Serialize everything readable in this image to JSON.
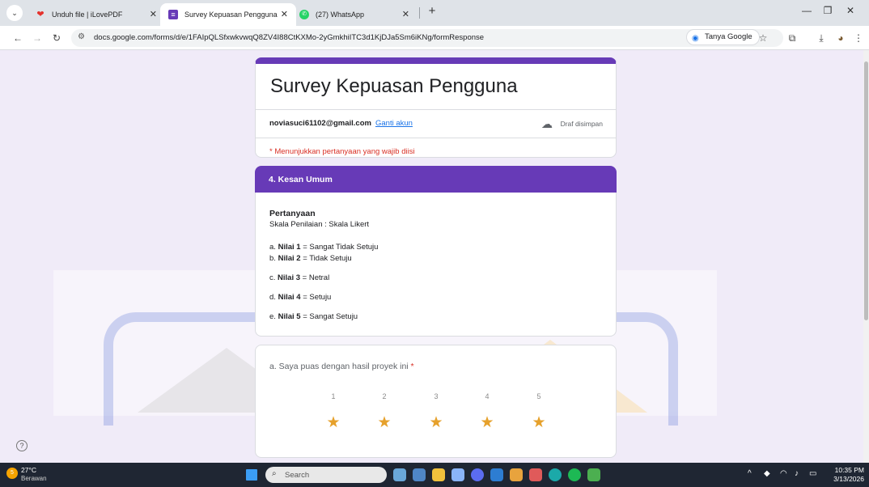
{
  "browser": {
    "tabs": [
      {
        "title": "Unduh file | iLovePDF",
        "icon": "heart-icon",
        "color": "#e5322d"
      },
      {
        "title": "Survey Kepuasan Pengguna",
        "icon": "forms-icon",
        "color": "#673ab7"
      },
      {
        "title": "(27) WhatsApp",
        "icon": "whatsapp-icon",
        "color": "#25d366"
      }
    ],
    "new_tab": "+",
    "url": "docs.google.com/forms/d/e/1FAIpQLSfxwkvwqQ8ZV4I88CtKXMo-2yGmkhiITC3d1KjDJa5Sm6iKNg/formResponse",
    "ask_google": "Tanya Google"
  },
  "form": {
    "title": "Survey Kepuasan Pengguna",
    "email": "noviasuci61102@gmail.com",
    "switch_account": "Ganti akun",
    "draft_status": "Draf disimpan",
    "required_note": "* Menunjukkan pertanyaan yang wajib diisi",
    "accent": "#673ab7"
  },
  "section": {
    "title": "4. Kesan Umum",
    "heading": "Pertanyaan",
    "scale": "Skala Penilaian : Skala Likert",
    "items": [
      {
        "prefix": "a.",
        "label": "Nilai 1",
        "desc": "= Sangat Tidak Setuju"
      },
      {
        "prefix": "b.",
        "label": "Nilai 2",
        "desc": "= Tidak Setuju"
      },
      {
        "prefix": "c.",
        "label": "Nilai 3",
        "desc": "= Netral"
      },
      {
        "prefix": "d.",
        "label": "Nilai 4",
        "desc": "= Setuju"
      },
      {
        "prefix": "e.",
        "label": "Nilai  5",
        "desc": "= Sangat Setuju"
      }
    ]
  },
  "question": {
    "text": "a. Saya puas dengan hasil proyek ini",
    "required_mark": "*",
    "ratings": [
      "1",
      "2",
      "3",
      "4",
      "5"
    ],
    "star_color": "#e6a12c"
  },
  "taskbar": {
    "temperature": "27°C",
    "condition": "Berawan",
    "weather_badge": "5",
    "search_placeholder": "Search",
    "time": "10:35 PM",
    "date": "3/13/2026"
  }
}
